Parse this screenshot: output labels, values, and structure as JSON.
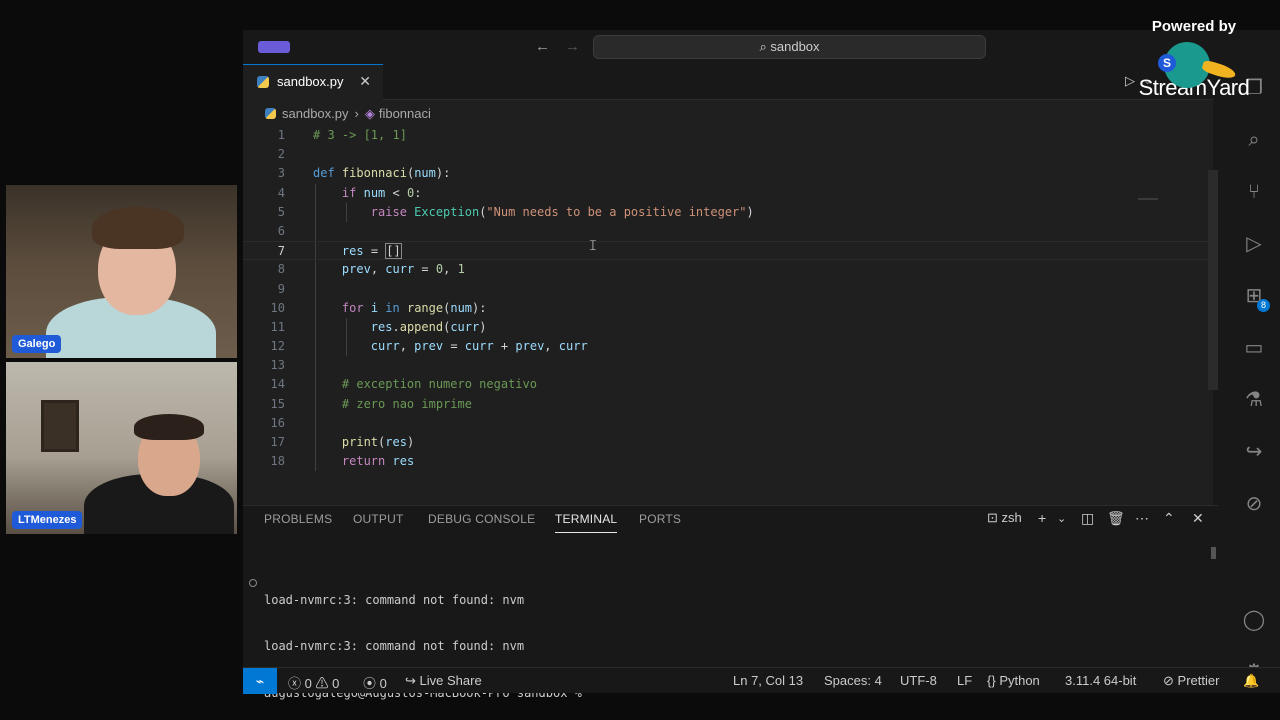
{
  "participants": [
    {
      "name": "Galego"
    },
    {
      "name": "LTMenezes"
    }
  ],
  "watermark": {
    "powered_by": "Powered by",
    "brand": "StreamYard",
    "badge": "S"
  },
  "titlebar": {
    "search_text": "sandbox",
    "back_icon": "arrow-left",
    "forward_icon": "arrow-right"
  },
  "tab": {
    "label": "sandbox.py",
    "close": "✕"
  },
  "breadcrumb": {
    "file": "sandbox.py",
    "symbol": "fibonnaci",
    "separator": "›"
  },
  "editor": {
    "lines": [
      {
        "n": "1"
      },
      {
        "n": "2"
      },
      {
        "n": "3"
      },
      {
        "n": "4"
      },
      {
        "n": "5"
      },
      {
        "n": "6"
      },
      {
        "n": "7"
      },
      {
        "n": "8"
      },
      {
        "n": "9"
      },
      {
        "n": "10"
      },
      {
        "n": "11"
      },
      {
        "n": "12"
      },
      {
        "n": "13"
      },
      {
        "n": "14"
      },
      {
        "n": "15"
      },
      {
        "n": "16"
      },
      {
        "n": "17"
      },
      {
        "n": "18"
      }
    ],
    "current_line": 7
  },
  "panel": {
    "tabs": [
      "PROBLEMS",
      "OUTPUT",
      "DEBUG CONSOLE",
      "TERMINAL",
      "PORTS"
    ],
    "active_tab": "TERMINAL",
    "shell": "zsh",
    "terminal_lines": [
      "load-nvmrc:3: command not found: nvm",
      "load-nvmrc:3: command not found: nvm",
      "augustogalego@Augustos-MacBook-Pro sandbox %"
    ]
  },
  "statusbar": {
    "errors": "0",
    "warnings": "0",
    "ports": "0",
    "live_share": "Live Share",
    "position": "Ln 7, Col 13",
    "spaces": "Spaces: 4",
    "encoding": "UTF-8",
    "eol": "LF",
    "language": "Python",
    "interpreter": "3.11.4 64-bit",
    "formatter": "Prettier"
  },
  "activity_badges": {
    "extensions": "8",
    "settings": "1"
  },
  "colors": {
    "accent": "#0078d4",
    "name_tag": "#1f5bd8",
    "editor_bg": "#1f1f1f",
    "chrome_bg": "#181818"
  }
}
